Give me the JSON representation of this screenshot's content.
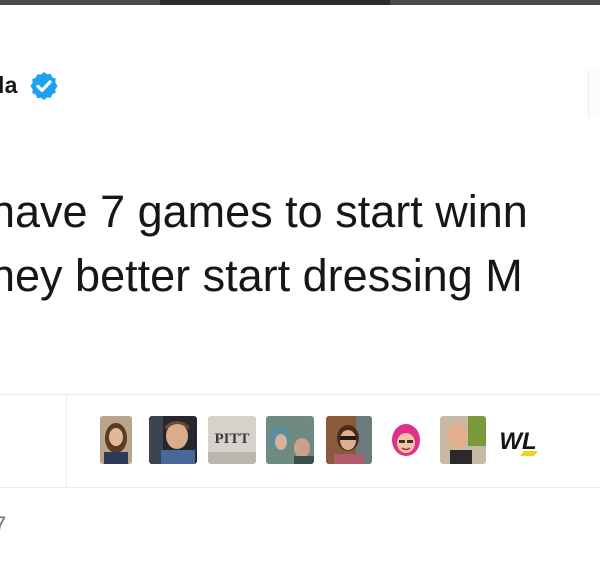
{
  "author": {
    "name_fragment": "la",
    "verified": true,
    "verified_color": "#1da1f2"
  },
  "tweet": {
    "line1": "have 7 games to start winn",
    "line2": "ney better start dressing M"
  },
  "likers": [
    {
      "name": "liker-1"
    },
    {
      "name": "liker-2"
    },
    {
      "name": "liker-3",
      "text": "PITT"
    },
    {
      "name": "liker-4"
    },
    {
      "name": "liker-5"
    },
    {
      "name": "liker-6"
    },
    {
      "name": "liker-7"
    },
    {
      "name": "liker-8",
      "text": "WL"
    }
  ],
  "timestamp_fragment": "7",
  "colors": {
    "text": "#14171a",
    "muted": "#657786",
    "border": "#e6ecf0",
    "accent": "#1da1f2"
  }
}
